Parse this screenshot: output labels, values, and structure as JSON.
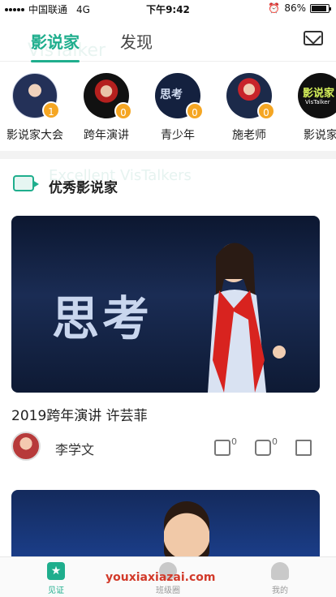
{
  "status_bar": {
    "carrier": "中国联通",
    "network": "4G",
    "time": "下午9:42",
    "battery": "86%"
  },
  "header": {
    "tabs": [
      {
        "label": "影说家",
        "active": true
      },
      {
        "label": "发现",
        "active": false
      }
    ],
    "watermark": "VisTalker"
  },
  "categories": [
    {
      "label": "影说家大会",
      "badge": "1"
    },
    {
      "label": "跨年演讲",
      "badge": "0"
    },
    {
      "label": "青少年",
      "badge": "0"
    },
    {
      "label": "施老师",
      "badge": "0"
    },
    {
      "label": "影说家",
      "badge": ""
    }
  ],
  "category_thumb_text": {
    "youth": "思考",
    "brand_logo": "影说家",
    "brand_logo_sub": "VisTalker"
  },
  "section": {
    "title": "优秀影说家",
    "watermark": "Excellent VisTalkers"
  },
  "card": {
    "image_text": "思考",
    "title": "2019跨年演讲 许芸菲",
    "author": "李学文",
    "likes": "0",
    "comments": "0"
  },
  "bottom_nav": [
    {
      "label": "见证",
      "active": true
    },
    {
      "label": "班级圈",
      "active": false
    },
    {
      "label": "我的",
      "active": false
    }
  ],
  "site_watermark": "youxiaxiazai.com",
  "colors": {
    "accent": "#1fae8d",
    "badge": "#f5a623",
    "watermark": "#d23a2a"
  }
}
